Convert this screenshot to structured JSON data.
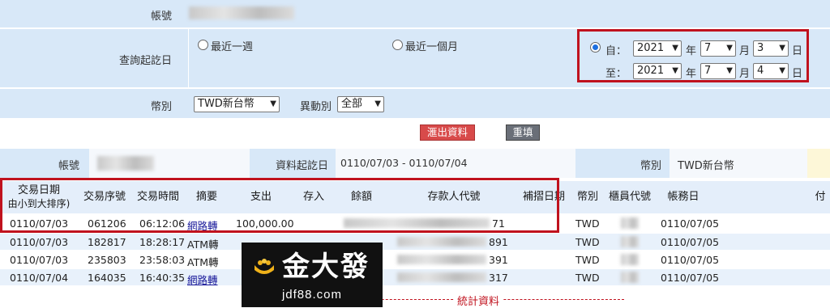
{
  "query_form": {
    "account_label": "帳號",
    "date_range_label": "查詢起訖日",
    "option_week": "最近一週",
    "option_month": "最近一個月",
    "from_label": "自：",
    "to_label": "至：",
    "from": {
      "year": "2021",
      "month": "7",
      "day": "3"
    },
    "to": {
      "year": "2021",
      "month": "7",
      "day": "4"
    },
    "year_unit": "年",
    "month_unit": "月",
    "day_unit": "日",
    "currency_label": "幣別",
    "currency_value": "TWD新台幣",
    "change_type_label": "異動別",
    "change_type_value": "全部",
    "export_button": "滙出資料",
    "reset_button": "重填"
  },
  "info_bar": {
    "account_label": "帳號",
    "date_range_label": "資料起訖日",
    "date_range_value": "0110/07/03 - 0110/07/04",
    "currency_label": "幣別",
    "currency_value": "TWD新台幣"
  },
  "table": {
    "headers": {
      "date_line1": "交易日期",
      "date_line2": "由小到大排序)",
      "seq": "交易序號",
      "time": "交易時間",
      "summary": "摘要",
      "withdraw": "支出",
      "deposit": "存入",
      "balance": "餘額",
      "depositor": "存款人代號",
      "repost_date": "補摺日期",
      "currency": "幣別",
      "teller": "櫃員代號",
      "book_date": "帳務日",
      "remarks": "付"
    },
    "rows": [
      {
        "date": "0110/07/03",
        "seq": "061206",
        "time": "06:12:06",
        "summary": "網路轉",
        "withdraw": "100,000.00",
        "depositor_tail": "71",
        "currency": "TWD",
        "book_date": "0110/07/05"
      },
      {
        "date": "0110/07/03",
        "seq": "182817",
        "time": "18:28:17",
        "summary": "ATM轉",
        "withdraw": "",
        "depositor_tail": "891",
        "currency": "TWD",
        "book_date": "0110/07/05"
      },
      {
        "date": "0110/07/03",
        "seq": "235803",
        "time": "23:58:03",
        "summary": "ATM轉",
        "withdraw": "",
        "depositor_tail": "391",
        "currency": "TWD",
        "book_date": "0110/07/05"
      },
      {
        "date": "0110/07/04",
        "seq": "164035",
        "time": "16:40:35",
        "summary": "網路轉",
        "withdraw": "",
        "depositor_tail": "317",
        "currency": "TWD",
        "book_date": "0110/07/05"
      }
    ],
    "stats_label": "統計資料"
  },
  "watermark": {
    "brand": "金大發",
    "site": "jdf88.com"
  },
  "colors": {
    "form_bg": "#d8e8f8",
    "highlight": "#c0121e",
    "link": "#1a1a9a",
    "export_button": "#d84a4a"
  }
}
